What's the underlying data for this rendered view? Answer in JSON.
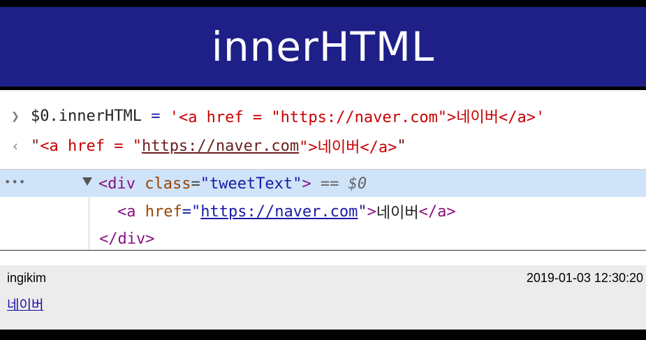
{
  "slide": {
    "title": "innerHTML"
  },
  "console": {
    "input_prompt_icon": "chevron-right-icon",
    "input_parts": [
      "$0.innerHTML",
      " = ",
      "'<a href = \"https://naver.com\">네이버</a>'"
    ],
    "output_prompt_icon": "return-arrow-icon",
    "output_parts": [
      "\"",
      "<a href = \"",
      "https://naver.com",
      "\">네이버</a>",
      "\""
    ]
  },
  "elements": {
    "more_icon": "ellipsis-icon",
    "expand_icon": "triangle-down-icon",
    "div_open": {
      "tag_open": "<div",
      "attr_name": " class",
      "eq": "=",
      "attr_value": "\"tweetText\"",
      "tag_close": ">",
      "selected_marker": " == $0"
    },
    "anchor": {
      "tag_open": "<a",
      "attr_name": " href",
      "eq": "=\"",
      "href": "https://naver.com",
      "close_quote": "\"",
      "tag_close": ">",
      "text": "네이버",
      "end_tag": "</a>"
    },
    "div_close": "</div>"
  },
  "tweet": {
    "user": "ingikim",
    "timestamp": "2019-01-03 12:30:20",
    "link_text": "네이버"
  },
  "colors": {
    "title_bg": "#1e2088",
    "selected_row_bg": "#cfe3f9",
    "tag": "#881280",
    "attr": "#994500",
    "value": "#1a1aa6",
    "string": "#c80000"
  }
}
